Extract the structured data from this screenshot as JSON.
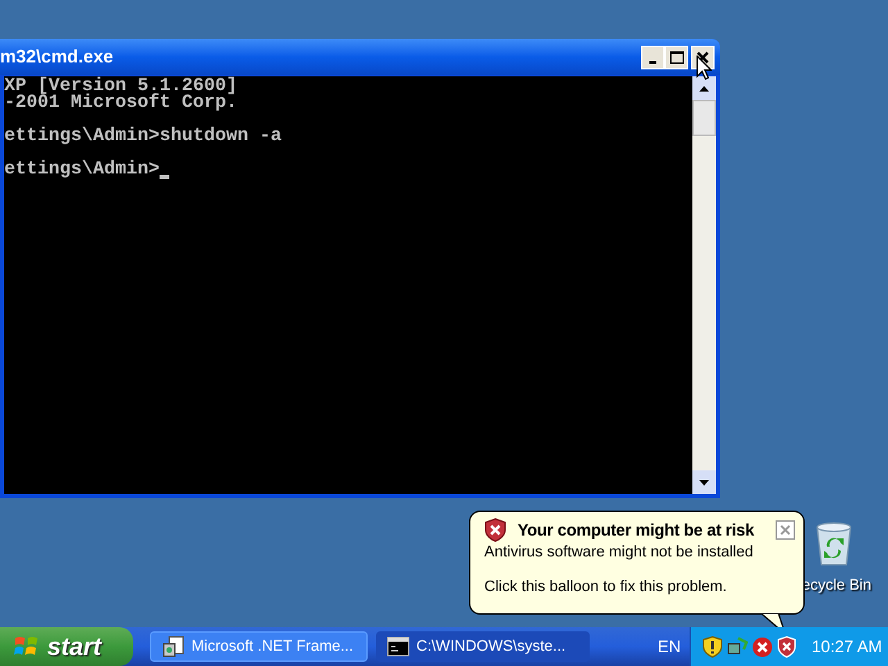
{
  "window": {
    "title": "m32\\cmd.exe",
    "lines": [
      {
        "text": "XP [Version 5.1.2600]",
        "blank_before": false,
        "cursor": false
      },
      {
        "text": "-2001 Microsoft Corp.",
        "blank_before": false,
        "cursor": false
      },
      {
        "text": "ettings\\Admin>shutdown -a",
        "blank_before": true,
        "cursor": false
      },
      {
        "text": "ettings\\Admin>",
        "blank_before": true,
        "cursor": true
      }
    ]
  },
  "desktop_icons": [
    {
      "label": "ecycle Bin"
    }
  ],
  "balloon": {
    "title": "Your computer might be at risk",
    "lines": [
      "Antivirus software might not be installed",
      "Click this balloon to fix this problem."
    ]
  },
  "taskbar": {
    "start": "start",
    "tasks": [
      {
        "label": "Microsoft .NET Frame...",
        "selected": false,
        "kind": "installer"
      },
      {
        "label": "C:\\WINDOWS\\syste...",
        "selected": true,
        "kind": "console"
      }
    ],
    "language": "EN",
    "clock": "10:27 AM"
  }
}
